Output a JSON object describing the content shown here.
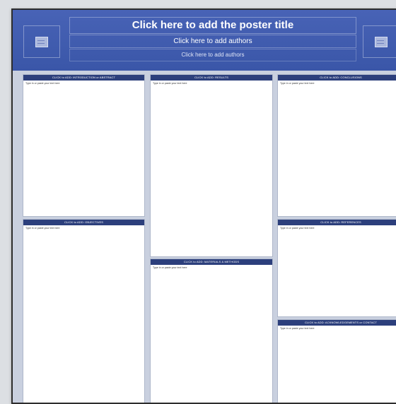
{
  "poster": {
    "title": "Click here to add the poster title",
    "authors": "Click here to add authors",
    "affiliations": "Click here to add authors",
    "logo_left": "logo-placeholder-icon",
    "logo_right": "logo-placeholder-icon",
    "colors": {
      "banner": "#3d59aa",
      "section_header": "#2c3f7c",
      "background": "#c9d0df"
    }
  },
  "sections": {
    "introduction": {
      "header": "CLICK to ADD: INTRODUCTION or ABSTRACT",
      "body": "Type in or paste your text here"
    },
    "objectives": {
      "header": "CLICK to ADD: OBJECTIVES",
      "body": "Type in or paste your text here"
    },
    "results": {
      "header": "CLICK to ADD: RESULTS",
      "body": "Type in or paste your text here"
    },
    "materials": {
      "header": "CLICK to ADD: MATERIALS & METHODS",
      "body": "Type in or paste your text here"
    },
    "conclusions": {
      "header": "CLICK to ADD: CONCLUSIONS",
      "body": "Type in or paste your text here"
    },
    "references": {
      "header": "CLICK to ADD: REFERENCES",
      "body": "Type in or paste your text here"
    },
    "acknowledgements": {
      "header": "CLICK to ADD: ACKNOWLEDGEMENTS or CONTACT",
      "body": "Type in or paste your text here"
    }
  }
}
